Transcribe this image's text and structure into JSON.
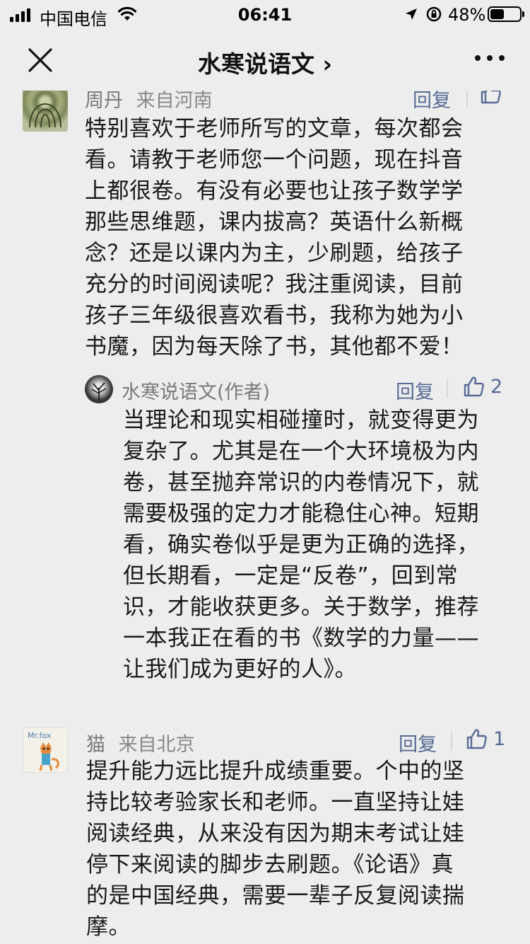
{
  "status_bar": {
    "carrier": "中国电信",
    "time": "06:41",
    "battery": "48%",
    "battery_level": 0.48
  },
  "nav": {
    "title": "水寒说语文 ›"
  },
  "comments": [
    {
      "name": "周丹",
      "location": "来自河南",
      "reply_label": "回复",
      "likes": "",
      "lines": [
        "特别喜欢于老师所写的文章，每次都会",
        "看。请教于老师您一个问题，现在抖音",
        "上都很卷。有没有必要也让孩子数学学",
        "那些思维题，课内拔高？英语什么新概",
        "念？还是以课内为主，少刷题，给孩子",
        "充分的时间阅读呢？我注重阅读，目前",
        "孩子三年级很喜欢看书，我称为她为小",
        "书魔，因为每天除了书，其他都不爱！"
      ],
      "reply": {
        "name": "水寒说语文(作者)",
        "reply_label": "回复",
        "likes": "2",
        "lines": [
          "当理论和现实相碰撞时，就变得更为",
          "复杂了。尤其是在一个大环境极为内",
          "卷，甚至抛弃常识的内卷情况下，就",
          "需要极强的定力才能稳住心神。短期",
          "看，确实卷似乎是更为正确的选择，",
          "但长期看，一定是“反卷”，回到常",
          "识，才能收获更多。关于数学，推荐",
          "一本我正在看的书《数学的力量——",
          "让我们成为更好的人》。"
        ]
      }
    },
    {
      "name": "猫",
      "location": "来自北京",
      "reply_label": "回复",
      "likes": "1",
      "lines": [
        "提升能力远比提升成绩重要。个中的坚",
        "持比较考验家长和老师。一直坚持让娃",
        "阅读经典，从来没有因为期末考试让娃",
        "停下来阅读的脚步去刷题。《论语》真",
        "的是中国经典，需要一辈子反复阅读揣",
        "摩。"
      ]
    }
  ],
  "colors": {
    "background": "#ededed",
    "link": "#576b95",
    "meta": "#888888",
    "text": "#191919"
  }
}
